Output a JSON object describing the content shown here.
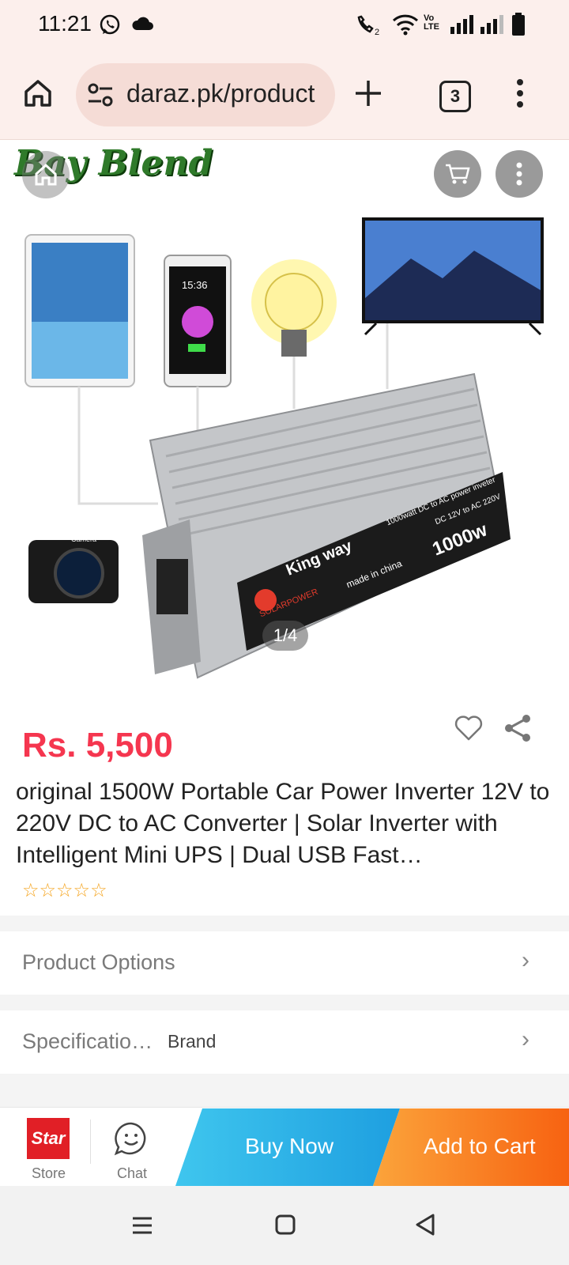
{
  "status_bar": {
    "time": "11:21",
    "icons": [
      "whatsapp-icon",
      "cloud-icon",
      "wifi-call-icon",
      "wifi-icon",
      "volte-icon",
      "signal-icon",
      "signal-icon",
      "battery-icon"
    ],
    "volte_label": "Vo LTE"
  },
  "browser": {
    "url": "daraz.pk/product",
    "tab_count": "3"
  },
  "gallery": {
    "store_logo_text": "Bay Blend",
    "pager": "1/4",
    "product_print": {
      "brand": "King way",
      "model_line1": "1000watt DC to AC power inveter",
      "model_line2": "DC 12V to AC 220V",
      "wattage": "1000w",
      "origin": "made in china",
      "series": "SOLARPOWER",
      "phone_time": "15:36",
      "camera_label": "Camera"
    }
  },
  "product": {
    "price": "Rs. 5,500",
    "title": "original 1500W Portable Car Power Inverter 12V to 220V DC to AC Converter | Solar Inverter with Intelligent Mini UPS | Dual USB Fast…",
    "rating_stars": 0
  },
  "sections": {
    "options_label": "Product Options",
    "specs_label": "Specificatio…",
    "specs_value": "Brand"
  },
  "action_bar": {
    "store_label": "Store",
    "store_logo": "Star",
    "chat_label": "Chat",
    "buy_now": "Buy Now",
    "add_to_cart": "Add to Cart"
  },
  "colors": {
    "price": "#f5364f",
    "buy_now_gradient": [
      "#3fc6ee",
      "#1e9fe0"
    ],
    "add_to_cart_gradient": [
      "#fba43b",
      "#f76211"
    ],
    "star": "#f5a623",
    "browser_bar": "#fcefec"
  }
}
